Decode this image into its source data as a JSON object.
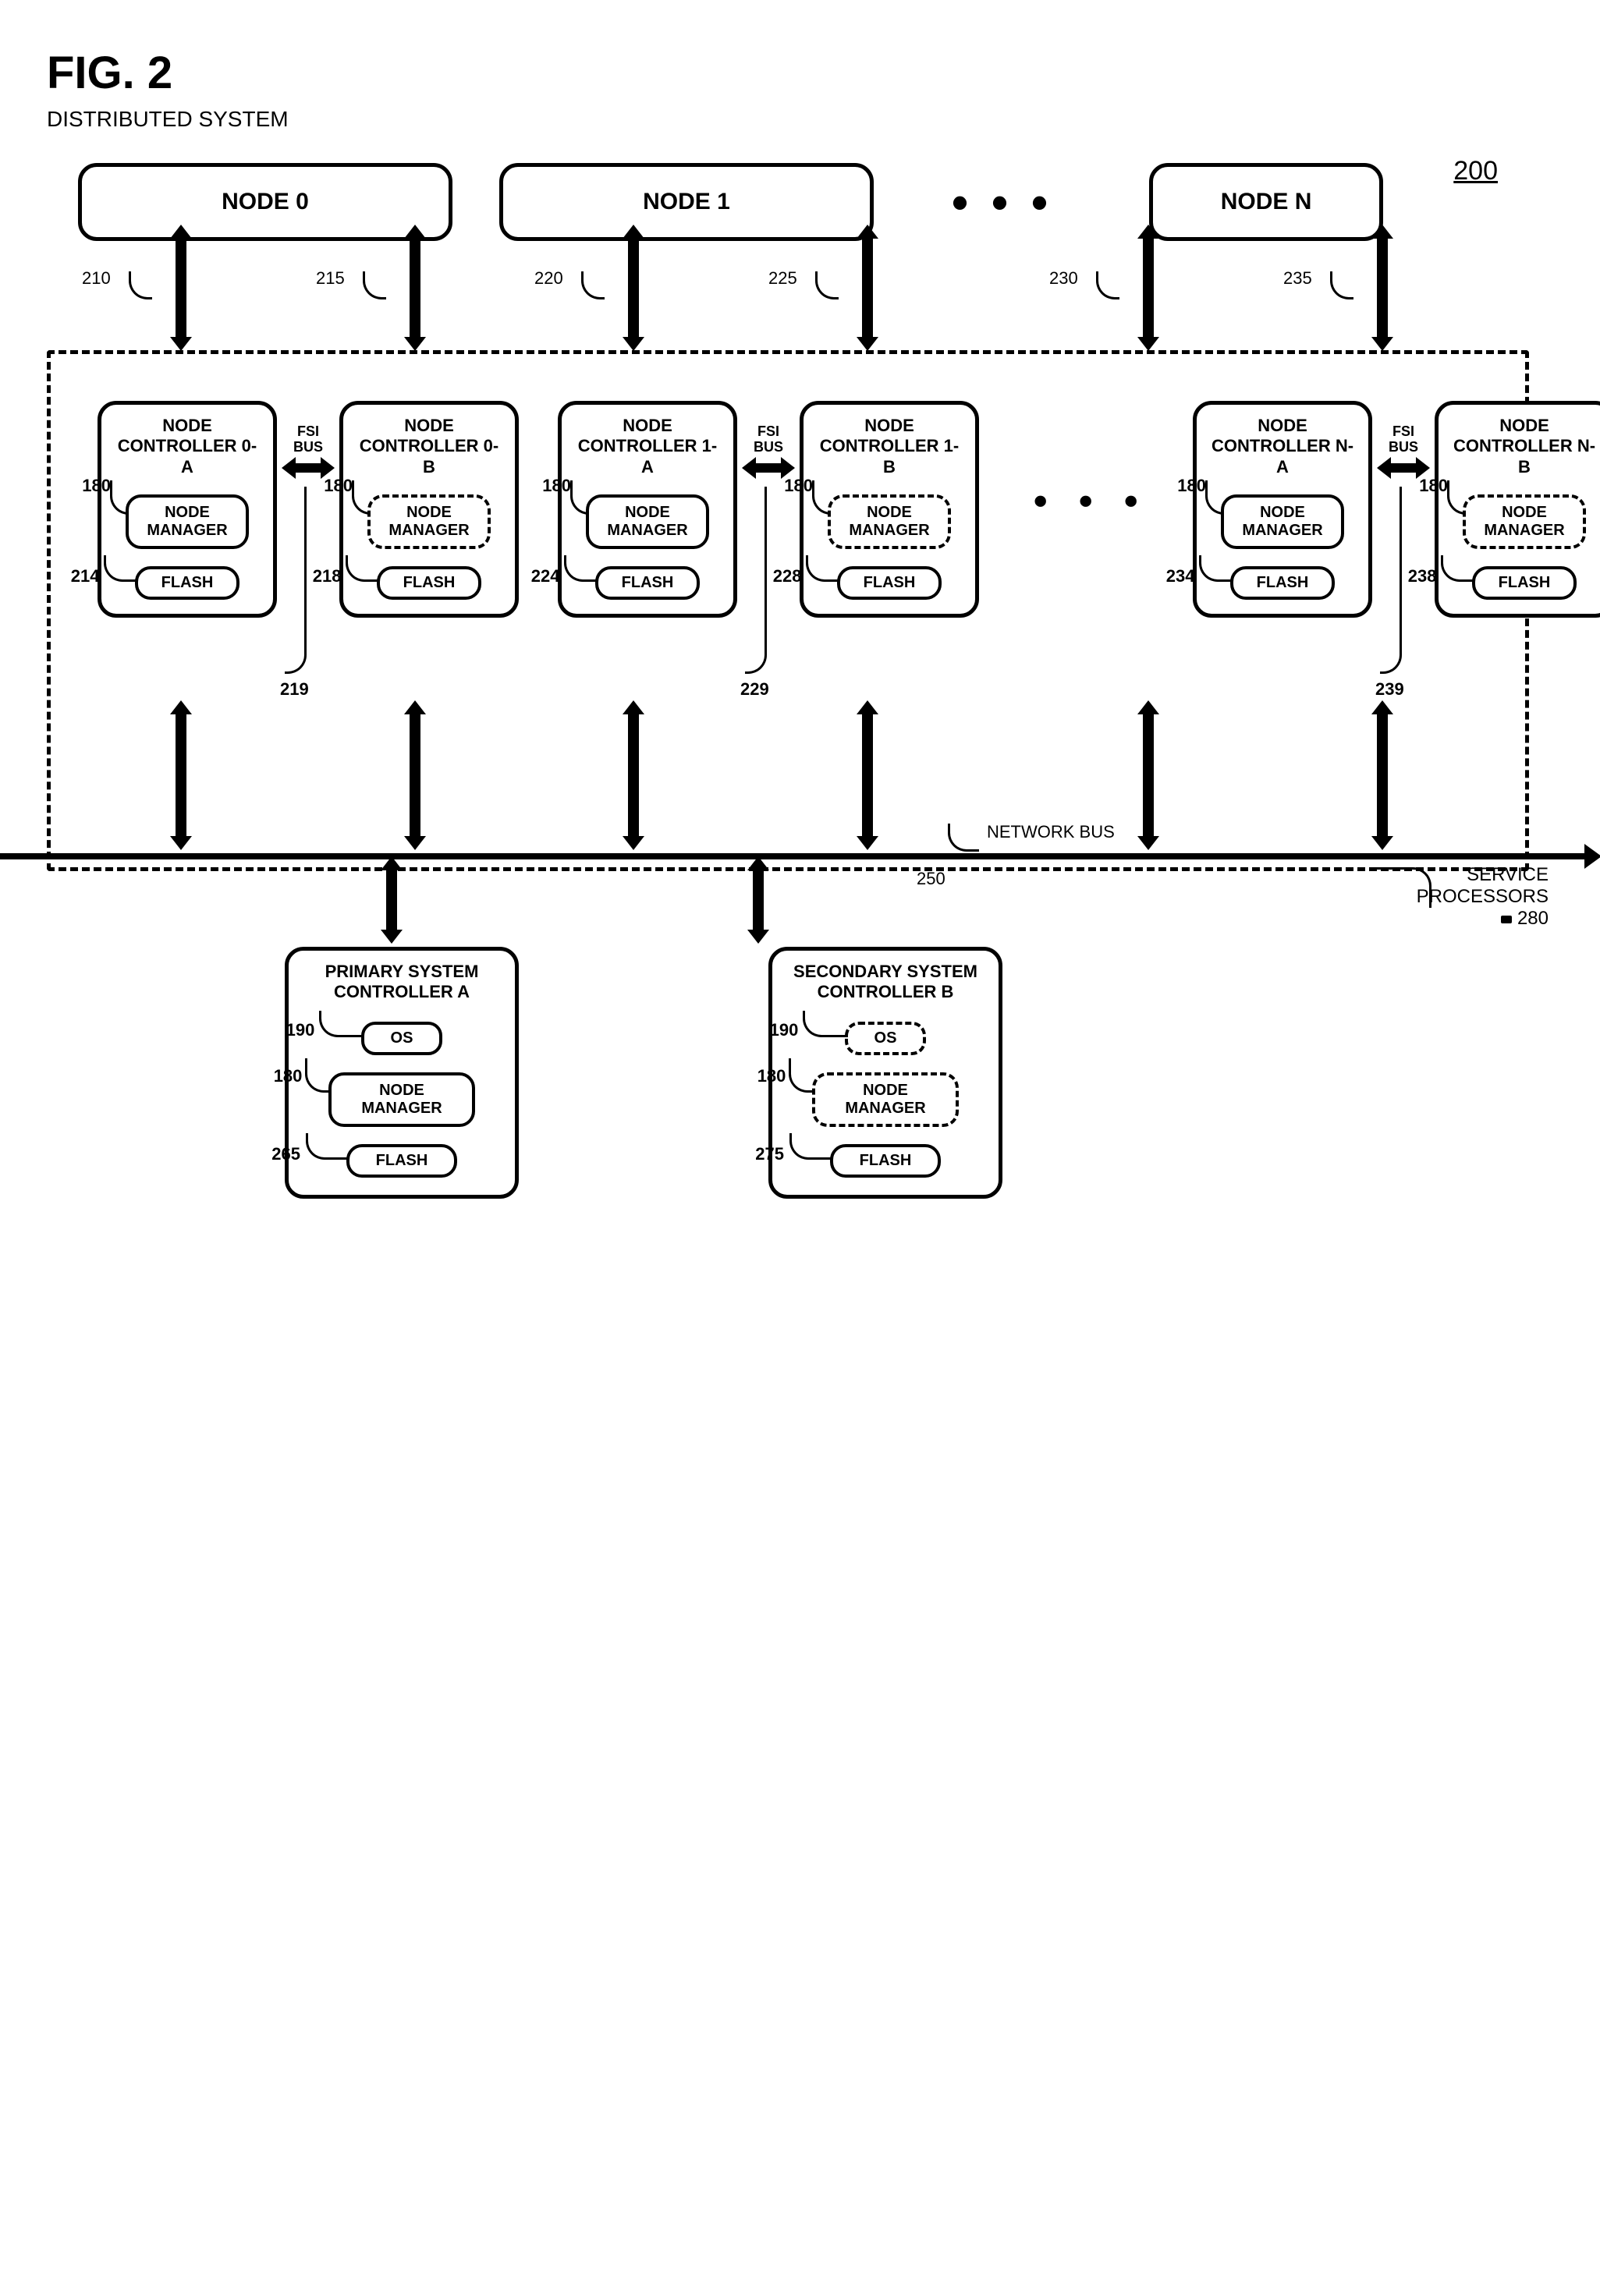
{
  "figure": {
    "label": "FIG. 2",
    "subtitle": "DISTRIBUTED SYSTEM",
    "ref": "200"
  },
  "nodes": [
    {
      "label": "NODE 0"
    },
    {
      "label": "NODE 1"
    },
    {
      "label": "NODE N"
    }
  ],
  "node_controllers": [
    {
      "a": {
        "title_l1": "NODE",
        "title_l2": "CONTROLLER 0-A",
        "nm_ref": "180",
        "nm_l1": "NODE",
        "nm_l2": "MANAGER",
        "nm_dashed": false,
        "flash": "FLASH",
        "flash_ref": "214",
        "top_ref": "210"
      },
      "b": {
        "title_l1": "NODE",
        "title_l2": "CONTROLLER 0-B",
        "nm_ref": "180",
        "nm_l1": "NODE",
        "nm_l2": "MANAGER",
        "nm_dashed": true,
        "flash": "FLASH",
        "flash_ref": "218",
        "top_ref": "215"
      },
      "fsi": {
        "l1": "FSI",
        "l2": "BUS",
        "ref": "219"
      }
    },
    {
      "a": {
        "title_l1": "NODE",
        "title_l2": "CONTROLLER 1-A",
        "nm_ref": "180",
        "nm_l1": "NODE",
        "nm_l2": "MANAGER",
        "nm_dashed": false,
        "flash": "FLASH",
        "flash_ref": "224",
        "top_ref": "220"
      },
      "b": {
        "title_l1": "NODE",
        "title_l2": "CONTROLLER 1-B",
        "nm_ref": "180",
        "nm_l1": "NODE",
        "nm_l2": "MANAGER",
        "nm_dashed": true,
        "flash": "FLASH",
        "flash_ref": "228",
        "top_ref": "225"
      },
      "fsi": {
        "l1": "FSI",
        "l2": "BUS",
        "ref": "229"
      }
    },
    {
      "a": {
        "title_l1": "NODE",
        "title_l2": "CONTROLLER N-A",
        "nm_ref": "180",
        "nm_l1": "NODE",
        "nm_l2": "MANAGER",
        "nm_dashed": false,
        "flash": "FLASH",
        "flash_ref": "234",
        "top_ref": "230"
      },
      "b": {
        "title_l1": "NODE",
        "title_l2": "CONTROLLER N-B",
        "nm_ref": "180",
        "nm_l1": "NODE",
        "nm_l2": "MANAGER",
        "nm_dashed": true,
        "flash": "FLASH",
        "flash_ref": "238",
        "top_ref": "235"
      },
      "fsi": {
        "l1": "FSI",
        "l2": "BUS",
        "ref": "239"
      }
    }
  ],
  "network_bus": {
    "label": "NETWORK BUS",
    "ref": "250"
  },
  "system_controllers": {
    "primary": {
      "title_l1": "PRIMARY SYSTEM",
      "title_l2": "CONTROLLER A",
      "os": "OS",
      "os_ref": "190",
      "os_dashed": false,
      "nm_l1": "NODE",
      "nm_l2": "MANAGER",
      "nm_ref": "180",
      "nm_dashed": false,
      "flash": "FLASH",
      "flash_ref": "265"
    },
    "secondary": {
      "title_l1": "SECONDARY SYSTEM",
      "title_l2": "CONTROLLER B",
      "os": "OS",
      "os_ref": "190",
      "os_dashed": true,
      "nm_l1": "NODE",
      "nm_l2": "MANAGER",
      "nm_ref": "180",
      "nm_dashed": true,
      "flash": "FLASH",
      "flash_ref": "275"
    }
  },
  "service_processors": {
    "label": "SERVICE\nPROCESSORS",
    "ref": "280"
  }
}
